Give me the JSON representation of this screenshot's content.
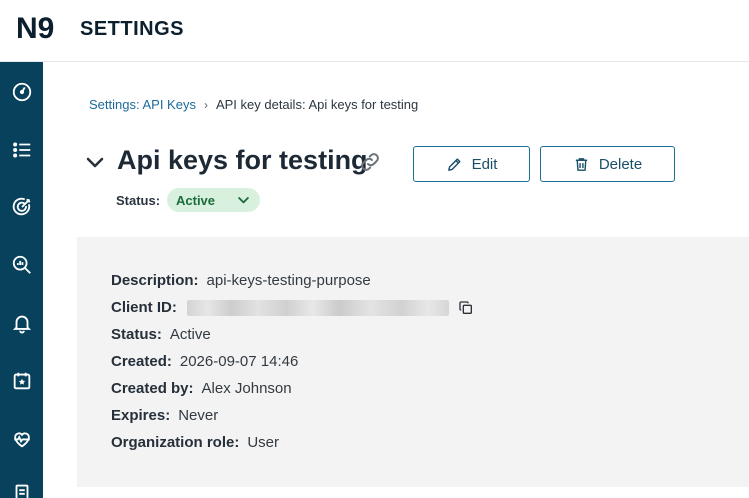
{
  "header": {
    "logo_text": "N9",
    "app_title": "SETTINGS"
  },
  "sidebar": {
    "items": [
      {
        "name": "dashboard-icon"
      },
      {
        "name": "list-icon"
      },
      {
        "name": "target-icon"
      },
      {
        "name": "analytics-search-icon"
      },
      {
        "name": "bell-icon"
      },
      {
        "name": "calendar-star-icon"
      },
      {
        "name": "health-icon"
      },
      {
        "name": "document-icon"
      }
    ]
  },
  "breadcrumb": {
    "parent": "Settings: API Keys",
    "separator": "›",
    "current": "API key details: Api keys for testing"
  },
  "page": {
    "title": "Api keys for testing"
  },
  "actions": {
    "edit_label": "Edit",
    "delete_label": "Delete"
  },
  "status": {
    "label": "Status:",
    "value": "Active"
  },
  "details": {
    "description_label": "Description:",
    "description_value": "api-keys-testing-purpose",
    "client_id_label": "Client ID:",
    "status_label": "Status:",
    "status_value": "Active",
    "created_label": "Created:",
    "created_value": "2026-09-07 14:46",
    "created_by_label": "Created by:",
    "created_by_value": "Alex Johnson",
    "expires_label": "Expires:",
    "expires_value": "Never",
    "org_role_label": "Organization role:",
    "org_role_value": "User"
  },
  "colors": {
    "sidebar": "#07415c",
    "accent": "#1a6f92",
    "link": "#1d6a9a",
    "active_pill_bg": "#d8f1df",
    "active_pill_text": "#1c6b3b",
    "panel_bg": "#f3f3f3"
  }
}
